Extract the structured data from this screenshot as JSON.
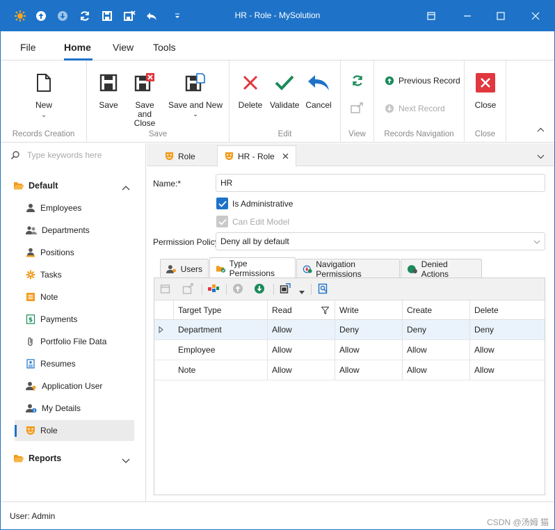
{
  "window": {
    "title": "HR - Role - MySolution"
  },
  "menu": {
    "tabs": [
      "File",
      "Home",
      "View",
      "Tools"
    ],
    "active": "Home"
  },
  "ribbon": {
    "groups": {
      "records_creation": "Records Creation",
      "save": "Save",
      "edit": "Edit",
      "view": "View",
      "records_navigation": "Records Navigation",
      "close": "Close"
    },
    "buttons": {
      "new": "New",
      "save": "Save",
      "save_close_1": "Save and",
      "save_close_2": "Close",
      "save_new": "Save and New",
      "delete": "Delete",
      "validate": "Validate",
      "cancel": "Cancel",
      "previous_record": "Previous Record",
      "next_record": "Next Record",
      "close": "Close"
    }
  },
  "nav": {
    "search_placeholder": "Type keywords here",
    "group_default": "Default",
    "group_reports": "Reports",
    "items": [
      "Employees",
      "Departments",
      "Positions",
      "Tasks",
      "Note",
      "Payments",
      "Portfolio File Data",
      "Resumes",
      "Application User",
      "My Details",
      "Role"
    ],
    "selected": "Role"
  },
  "doc_tabs": [
    "Role",
    "HR - Role"
  ],
  "form": {
    "name_label": "Name:*",
    "name_value": "HR",
    "is_admin_label": "Is Administrative",
    "is_admin_checked": true,
    "can_edit_model_label": "Can Edit Model",
    "permission_policy_label": "Permission Policy:",
    "permission_policy_value": "Deny all by default"
  },
  "inner_tabs": [
    "Users",
    "Type Permissions",
    "Navigation Permissions",
    "Denied Actions"
  ],
  "inner_tab_active": "Type Permissions",
  "grid": {
    "columns": [
      "Target Type",
      "Read",
      "Write",
      "Create",
      "Delete"
    ],
    "rows": [
      [
        "Department",
        "Allow",
        "Deny",
        "Deny",
        "Deny"
      ],
      [
        "Employee",
        "Allow",
        "Allow",
        "Allow",
        "Allow"
      ],
      [
        "Note",
        "Allow",
        "Allow",
        "Allow",
        "Allow"
      ]
    ]
  },
  "status": {
    "user": "User: Admin",
    "watermark": "CSDN @汤姆 猫"
  },
  "colors": {
    "accent": "#1e73c8",
    "delete_red": "#e0383e",
    "validate_green": "#1b8a5a",
    "role_orange": "#f29c1f"
  }
}
